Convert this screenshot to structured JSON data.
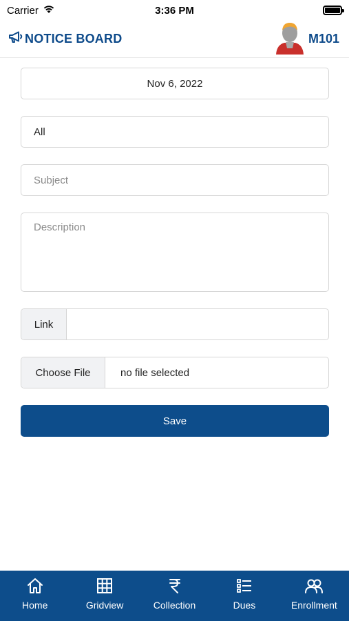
{
  "status_bar": {
    "carrier": "Carrier",
    "time": "3:36 PM"
  },
  "header": {
    "title": "NOTICE BOARD",
    "user_code": "M101",
    "icon": "megaphone-icon"
  },
  "form": {
    "date": "Nov 6, 2022",
    "audience": "All",
    "subject": {
      "placeholder": "Subject",
      "value": ""
    },
    "description": {
      "placeholder": "Description",
      "value": ""
    },
    "link": {
      "label": "Link",
      "value": ""
    },
    "file": {
      "button_label": "Choose File",
      "status": "no file selected"
    },
    "save_label": "Save"
  },
  "bottom_nav": {
    "items": [
      {
        "label": "Home",
        "icon": "home-icon"
      },
      {
        "label": "Gridview",
        "icon": "grid-icon"
      },
      {
        "label": "Collection",
        "icon": "rupee-icon"
      },
      {
        "label": "Dues",
        "icon": "list-icon"
      },
      {
        "label": "Enrollment",
        "icon": "users-icon"
      }
    ]
  },
  "colors": {
    "brand": "#0d4d8b",
    "header_text": "#0d4a8a",
    "background": "#ffffff"
  }
}
